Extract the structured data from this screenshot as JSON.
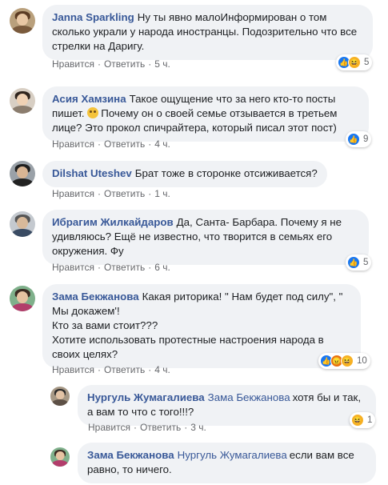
{
  "actions": {
    "like": "Нравится",
    "reply": "Ответить",
    "sep": "·"
  },
  "comments": [
    {
      "author": "Janna Sparkling",
      "text": "Ну ты явно малоИнформирован о том сколько украли у народа иностранцы. Подозрительно что все стрелки на Даригу.",
      "time": "5 ч.",
      "reaction_count": "5",
      "reactions": [
        "like-icon",
        "haha-icon"
      ]
    },
    {
      "author": "Асия Хамзина",
      "text_part1": "Такое ощущение что за него кто-то посты пишет.",
      "text_part2": "Почему он о своей семье отзывается в третьем лице? Это прокол спичрайтера, который писал этот пост)",
      "time": "4 ч.",
      "reaction_count": "9",
      "reactions": [
        "like-icon"
      ]
    },
    {
      "author": "Dilshat Uteshev",
      "text": "Брат тоже в сторонке отсиживается?",
      "time": "1 ч."
    },
    {
      "author": "Ибрагим Жилкайдаров",
      "text": "Да, Санта- Барбара. Почему я не удивляюсь? Ещё не известно, что творится в семьях его окружения. Фу",
      "time": "6 ч.",
      "reaction_count": "5",
      "reactions": [
        "like-icon"
      ]
    },
    {
      "author": "Зама Бекжанова",
      "text": "Какая риторика! \" Нам будет под силу\", \" Мы докажем'!",
      "text2": "Кто за вами стоит???",
      "text3": "Хотите использовать протестные настроения народа в своих целях?",
      "time": "4 ч.",
      "reaction_count": "10",
      "reactions": [
        "like-icon",
        "angry-icon",
        "haha-icon"
      ]
    }
  ],
  "replies": [
    {
      "author": "Нургуль Жумагалиева",
      "mention": "Зама Бекжанова",
      "text": "хотя бы и так, а вам то что с того!!!?",
      "time": "3 ч.",
      "reaction_count": "1",
      "reactions": [
        "haha-icon"
      ]
    },
    {
      "author": "Зама Бекжанова",
      "mention": "Нургуль Жумагалиева",
      "text": "если вам все равно, то ничего."
    }
  ],
  "colors": {
    "author": "#385898",
    "bubble": "#f0f2f5",
    "meta": "#65676b",
    "like": "#1877f2",
    "haha": "#f7b125",
    "angry": "#e9710f"
  }
}
